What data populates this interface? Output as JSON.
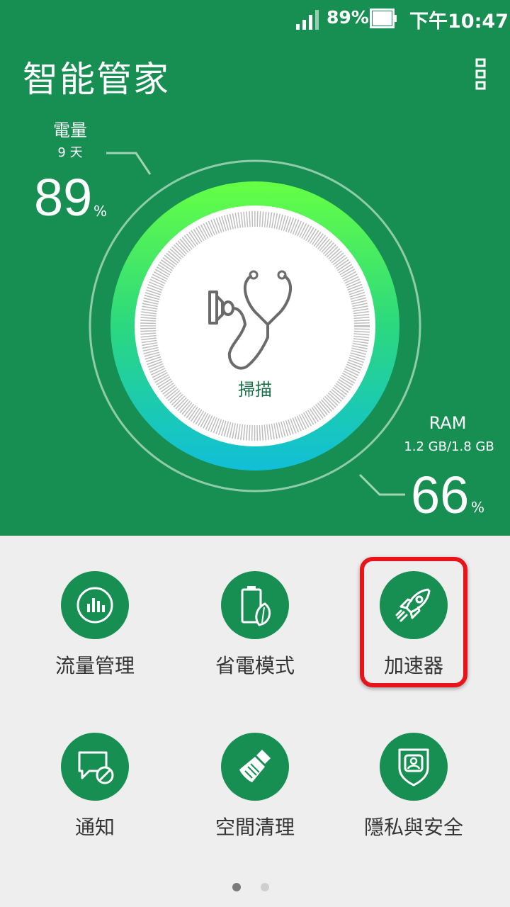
{
  "status_bar": {
    "battery_percent": "89%",
    "time": "下午10:47"
  },
  "header": {
    "title": "智能管家"
  },
  "battery": {
    "label": "電量",
    "days": "9 天",
    "value": "89",
    "unit": "%"
  },
  "ram": {
    "label": "RAM",
    "usage": "1.2 GB/1.8 GB",
    "value": "66",
    "unit": "%"
  },
  "scan": {
    "label": "掃描"
  },
  "tiles": [
    {
      "label": "流量管理",
      "icon": "bar-chart-icon"
    },
    {
      "label": "省電模式",
      "icon": "battery-leaf-icon"
    },
    {
      "label": "加速器",
      "icon": "rocket-icon"
    },
    {
      "label": "通知",
      "icon": "message-block-icon"
    },
    {
      "label": "空間清理",
      "icon": "broom-icon"
    },
    {
      "label": "隱私與安全",
      "icon": "shield-user-icon"
    }
  ],
  "colors": {
    "primary": "#178f52",
    "highlight": "#e8131b",
    "gradient_top": "#66ff44",
    "gradient_bottom": "#10bfd8"
  },
  "pager": {
    "total": 2,
    "current": 1
  }
}
